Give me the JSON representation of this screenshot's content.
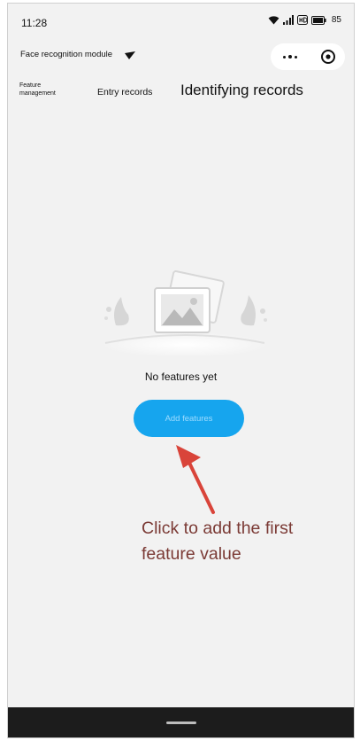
{
  "status_bar": {
    "time": "11:28",
    "battery": "85",
    "icons": [
      "wifi-icon",
      "signal-icon",
      "hd-icon",
      "battery-icon"
    ]
  },
  "header": {
    "title": "Face recognition module",
    "capsule_icons": [
      "more-icon",
      "close-target-icon"
    ]
  },
  "tabs": [
    {
      "label": "Feature management"
    },
    {
      "label": "Entry records"
    },
    {
      "label": "Identifying records"
    }
  ],
  "empty_state": {
    "message": "No features yet",
    "button_label": "Add features"
  },
  "annotation": {
    "text": "Click to add the first feature value",
    "color": "#d9443a"
  },
  "colors": {
    "accent": "#16a5ee",
    "background": "#f2f2f2"
  }
}
